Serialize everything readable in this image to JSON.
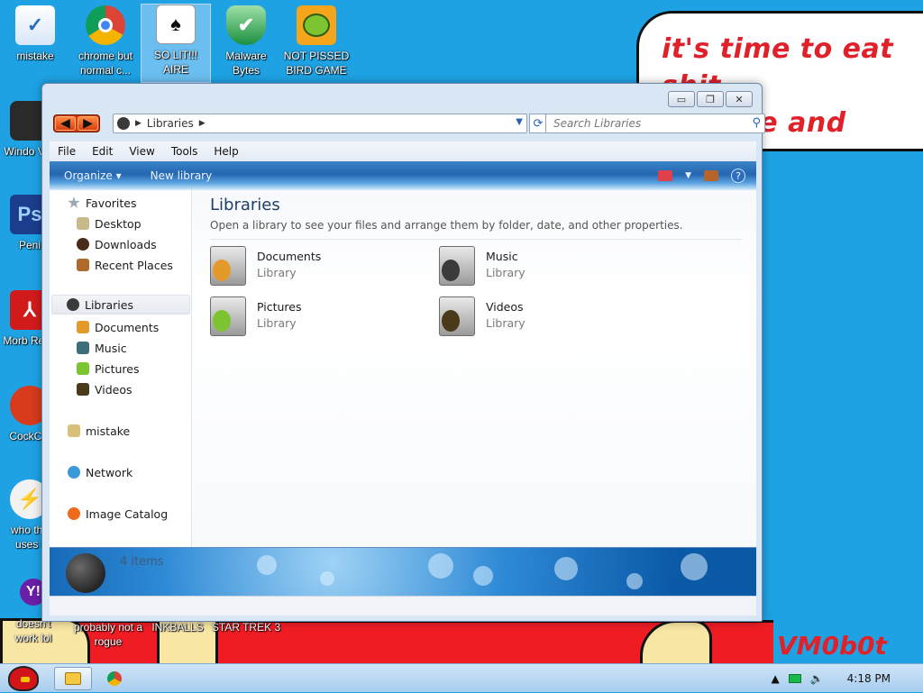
{
  "desktop": {
    "speech_bubble": "it's time to eat shit\nand die and chew\ngum",
    "signature": "VM0b0t",
    "icons_top": [
      {
        "label": "mistake",
        "color": "#3a7fd0"
      },
      {
        "label": "chrome but normal c...",
        "color": "#e8e8e8"
      },
      {
        "label": "SO LIT!!! AIRE",
        "color": "#ffffff"
      },
      {
        "label": "Malware Bytes",
        "color": "#1a8f3e"
      },
      {
        "label": "NOT PISSED BIRD GAME",
        "color": "#f4a51c"
      }
    ],
    "icons_left": [
      {
        "label": "Windo Vist",
        "color": "#2a2a2a"
      },
      {
        "label": "Peni",
        "color": "#1c3d8c"
      },
      {
        "label": "Morb Read",
        "color": "#d11b1b"
      },
      {
        "label": "CockCle",
        "color": "#d83a1c"
      },
      {
        "label": "who the uses t",
        "color": "#f2f2f2"
      }
    ],
    "icons_bottom": [
      {
        "label": "doesn't work lol"
      },
      {
        "label": "probably not a rogue"
      },
      {
        "label": "INKBALLS"
      },
      {
        "label": "STAR TREK 3"
      }
    ]
  },
  "window": {
    "address": {
      "crumb": "Libraries"
    },
    "search": {
      "placeholder": "Search Libraries"
    },
    "menu": [
      "File",
      "Edit",
      "View",
      "Tools",
      "Help"
    ],
    "toolbar": {
      "organize": "Organize",
      "new_library": "New library"
    },
    "nav": {
      "favorites": "Favorites",
      "desktop": "Desktop",
      "downloads": "Downloads",
      "recent": "Recent Places",
      "libraries": "Libraries",
      "documents": "Documents",
      "music": "Music",
      "pictures": "Pictures",
      "videos": "Videos",
      "mistake": "mistake",
      "network": "Network",
      "image_catalog": "Image Catalog"
    },
    "content": {
      "title": "Libraries",
      "description": "Open a library to see your files and arrange them by folder, date, and other properties.",
      "libraries": [
        {
          "name": "Documents",
          "type": "Library"
        },
        {
          "name": "Music",
          "type": "Library"
        },
        {
          "name": "Pictures",
          "type": "Library"
        },
        {
          "name": "Videos",
          "type": "Library"
        }
      ]
    },
    "details": {
      "count": "4 items"
    }
  },
  "taskbar": {
    "clock": "4:18 PM"
  }
}
